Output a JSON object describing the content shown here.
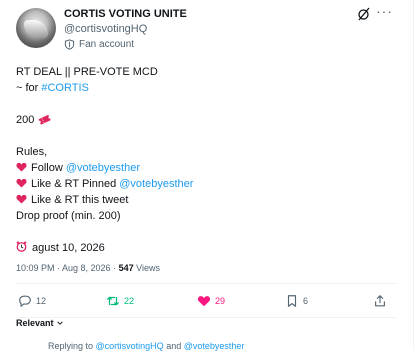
{
  "author": {
    "name": "CORTIS VOTING UNITE",
    "handle": "@cortisvotingHQ",
    "badge_label": "Fan account"
  },
  "post": {
    "line1": "RT DEAL || PRE-VOTE MCD",
    "line2_prefix": "~ for ",
    "line2_hashtag": "#CORTIS",
    "count_line": "200",
    "rules_label": "Rules,",
    "rule1_prefix": "Follow ",
    "rule1_mention": "@votebyesther",
    "rule2_prefix": "Like & RT Pinned ",
    "rule2_mention": "@votebyesther",
    "rule3": "Like & RT this tweet",
    "rule4": "Drop proof (min. 200)",
    "deadline": "agust 10, 2026"
  },
  "meta": {
    "timestamp": "10:09 PM · Aug 8, 2026 · ",
    "views_count": "547",
    "views_label": " Views"
  },
  "actions": {
    "replies": "12",
    "reposts": "22",
    "likes": "29",
    "bookmarks": "6"
  },
  "colors": {
    "link": "#1d9bf0",
    "repost_active": "#00ba7c",
    "like_active": "#f91880",
    "muted": "#536471"
  },
  "replies_section": {
    "sort_label": "Relevant",
    "replying_prefix": "Replying to ",
    "replying_to_1": "@cortisvotingHQ",
    "replying_and": " and ",
    "replying_to_2": "@votebyesther"
  }
}
